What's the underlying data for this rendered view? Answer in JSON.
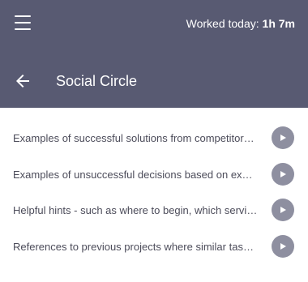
{
  "header": {
    "worked_label": "Worked today:",
    "worked_value": "1h 7m",
    "title": "Social Circle",
    "menu_icon": "menu-icon",
    "back_icon": "arrow-left-icon"
  },
  "list": {
    "items": [
      {
        "label": "Examples of successful solutions from competitors' examples"
      },
      {
        "label": "Examples of unsuccessful decisions based on experience"
      },
      {
        "label": "Helpful hints - such as where to begin, which services to use"
      },
      {
        "label": "References to previous projects where similar tasks were solved"
      }
    ],
    "play_icon": "play-icon"
  },
  "colors": {
    "header_bg": "#585a72",
    "play_bg": "#8e8fa0",
    "text": "#4c4c5a"
  }
}
